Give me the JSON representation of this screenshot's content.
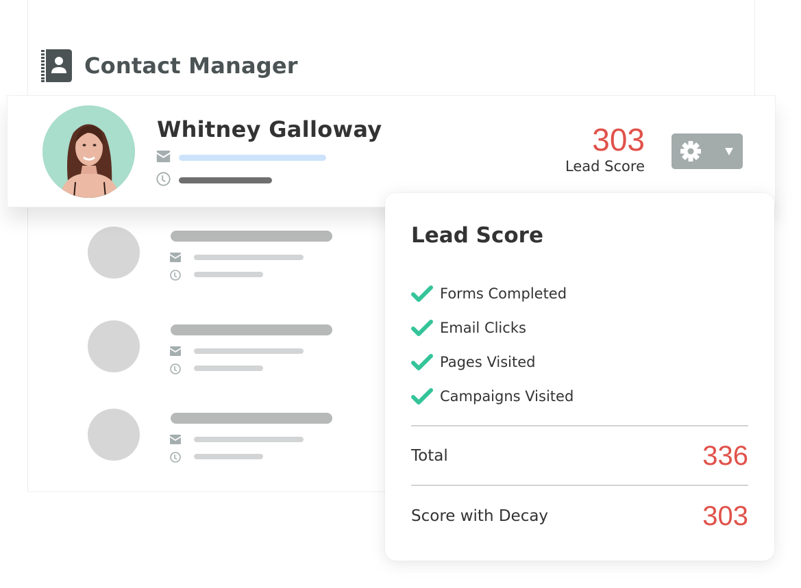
{
  "header": {
    "icon": "contact-book-icon",
    "title": "Contact Manager"
  },
  "contact": {
    "name": "Whitney Galloway",
    "avatar": "avatar-photo",
    "email_icon": "envelope-icon",
    "time_icon": "clock-icon",
    "lead_score": "303",
    "lead_score_label": "Lead Score",
    "settings_button": {
      "icon": "gear-icon",
      "caret": "caret-down-icon"
    }
  },
  "placeholder_contacts": [
    {
      "id": 1
    },
    {
      "id": 2
    },
    {
      "id": 3
    }
  ],
  "lead_popup": {
    "title": "Lead Score",
    "criteria": [
      {
        "label": "Forms Completed",
        "icon": "check-icon",
        "checked": true
      },
      {
        "label": "Email Clicks",
        "icon": "check-icon",
        "checked": true
      },
      {
        "label": "Pages Visited",
        "icon": "check-icon",
        "checked": true
      },
      {
        "label": "Campaigns Visited",
        "icon": "check-icon",
        "checked": true
      }
    ],
    "total_label": "Total",
    "total_value": "336",
    "decay_label": "Score with Decay",
    "decay_value": "303"
  },
  "colors": {
    "accent_red": "#e0524a",
    "check_green": "#35c49a",
    "avatar_bg": "#a9ddcc",
    "button_gray": "#a3abab",
    "header_text": "#4b5354"
  }
}
